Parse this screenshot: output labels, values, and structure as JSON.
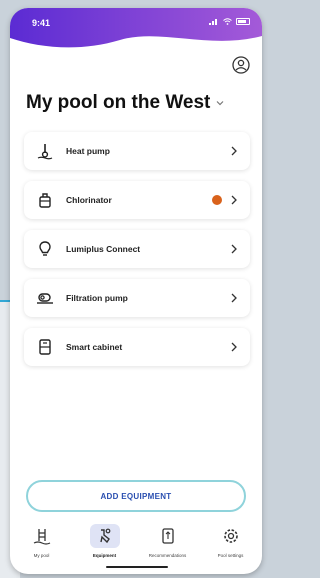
{
  "status_bar": {
    "time": "9:41"
  },
  "header": {
    "title": "My pool on the West"
  },
  "equipment": [
    {
      "label": "Heat pump",
      "icon": "thermometer-icon"
    },
    {
      "label": "Chlorinator",
      "icon": "chlorinator-icon",
      "status_color": "#d9621b"
    },
    {
      "label": "Lumiplus Connect",
      "icon": "lightbulb-icon"
    },
    {
      "label": "Filtration pump",
      "icon": "pump-icon"
    },
    {
      "label": "Smart cabinet",
      "icon": "cabinet-icon"
    }
  ],
  "add_button_label": "ADD EQUIPMENT",
  "tabs": [
    {
      "label": "My pool",
      "icon": "pool-ladder-icon"
    },
    {
      "label": "Equipment",
      "icon": "equipment-icon",
      "active": true
    },
    {
      "label": "Recommendations",
      "icon": "recommendations-icon"
    },
    {
      "label": "Pool settings",
      "icon": "gear-icon"
    }
  ],
  "colors": {
    "header_gradient_start": "#5b2bd3",
    "header_gradient_end": "#a45ad8",
    "accent_dot": "#d9621b",
    "button_border": "#8fd3db",
    "button_text": "#2a4fb0"
  }
}
